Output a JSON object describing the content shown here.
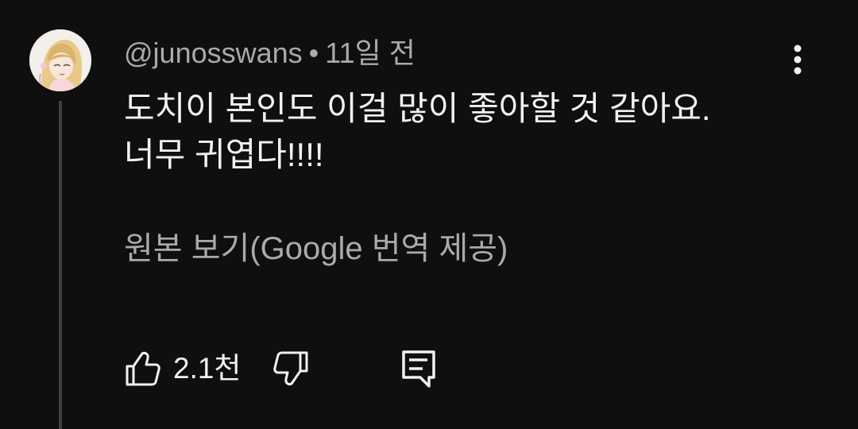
{
  "comment": {
    "author": "@junosswans",
    "separator": "•",
    "time": "11일 전",
    "text_lines": [
      "도치이 본인도 이걸 많이 좋아할 것 같아요.",
      "너무 귀엽다!!!!"
    ],
    "translate_label": "원본 보기(Google 번역 제공)",
    "like_count": "2.1천"
  },
  "icons": {
    "avatar": "anime-girl-avatar",
    "more": "more-vertical-icon",
    "like": "thumbs-up-icon",
    "dislike": "thumbs-down-icon",
    "reply": "comment-reply-icon"
  },
  "colors": {
    "background": "#0f0f0f",
    "primary_text": "#f1f1f1",
    "secondary_text": "#aaaaaa",
    "thread_line": "#3f3f3f"
  }
}
